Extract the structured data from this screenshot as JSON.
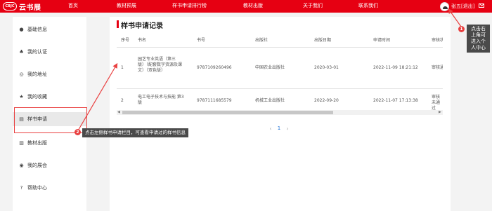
{
  "header": {
    "logo_badge": "CBJC",
    "logo_text": "云书展",
    "nav": [
      "首页",
      "教材预展",
      "样书申请排行榜",
      "教材出版",
      "关于我们",
      "联系我们"
    ],
    "user_label": "张五[退出]"
  },
  "sidebar": {
    "items": [
      {
        "label": "基础信息",
        "icon": "user-icon"
      },
      {
        "label": "我的认证",
        "icon": "badge-icon"
      },
      {
        "label": "我的地址",
        "icon": "location-pin-icon"
      },
      {
        "label": "我的收藏",
        "icon": "star-icon"
      },
      {
        "label": "样书申请",
        "icon": "document-icon"
      },
      {
        "label": "教材出版",
        "icon": "book-icon"
      },
      {
        "label": "我的展会",
        "icon": "globe-icon"
      },
      {
        "label": "帮助中心",
        "icon": "help-icon"
      }
    ]
  },
  "main": {
    "title": "样书申请记录",
    "columns": [
      "序号",
      "书名",
      "书号",
      "出版社",
      "出版日期",
      "申请时间",
      "审核状态"
    ],
    "rows": [
      {
        "index": "1",
        "title": "园艺专业英语（第三版）（配套数字资源及课文）（双色版）",
        "isbn": "9787109260496",
        "publisher": "中国农业出版社",
        "pub_date": "2020-03-01",
        "apply_time": "2022-11-09 18:21:12",
        "status": "审核通过"
      },
      {
        "index": "2",
        "title": "电工电子技术与技能 第3版",
        "isbn": "9787111685579",
        "publisher": "机械工业出版社",
        "pub_date": "2022-09-20",
        "apply_time": "2022-11-07 17:13:38",
        "status": "审核未通过"
      }
    ],
    "pagination": {
      "prev": "‹",
      "current": "1",
      "next": "›"
    }
  },
  "annotations": {
    "badge1": "1",
    "badge2": "2",
    "tip1": "点击右上角可进入个人中心",
    "tip2": "点击左侧样书申请栏目，可查看申请过的样书信息",
    "color": "#e94040"
  }
}
